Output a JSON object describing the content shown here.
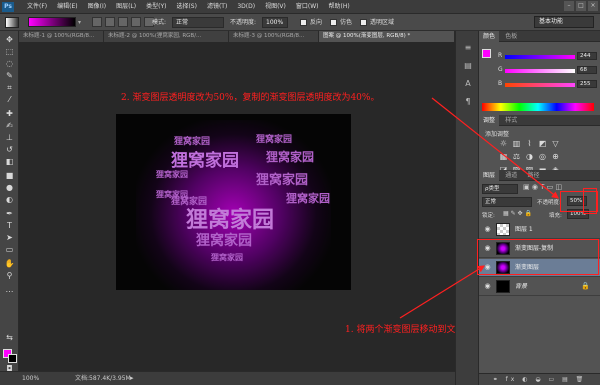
{
  "menubar": {
    "logo": "Ps",
    "items": [
      "文件(F)",
      "编辑(E)",
      "图像(I)",
      "图层(L)",
      "类型(Y)",
      "选择(S)",
      "滤镜(T)",
      "3D(D)",
      "视图(V)",
      "窗口(W)",
      "帮助(H)"
    ],
    "win_min": "–",
    "win_max": "□",
    "win_close": "×"
  },
  "options": {
    "mode_label": "模式:",
    "mode_value": "正常",
    "opacity_label": "不透明度:",
    "opacity_value": "100%",
    "reverse_label": "反向",
    "dither_label": "仿色",
    "transparency_label": "透明区域",
    "workspace": "基本功能"
  },
  "tabs": [
    {
      "label": "未标题-1 @ 100%(RGB/8...",
      "active": false
    },
    {
      "label": "未标题-2 @ 100%(狸窝家园, RGB/...",
      "active": false
    },
    {
      "label": "未标题-3 @ 100%(RGB/8...",
      "active": false
    },
    {
      "label": "图案 @ 100%(渐变图层, RGB/8) *",
      "active": true
    }
  ],
  "canvas": {
    "heart_words": [
      {
        "text": "狸窝家园",
        "size": 9
      },
      {
        "text": "狸窝家园",
        "size": 17
      },
      {
        "text": "狸窝家园",
        "size": 9
      },
      {
        "text": "狸窝家园",
        "size": 12
      },
      {
        "text": "狸窝家园",
        "size": 8
      },
      {
        "text": "狸窝家园",
        "size": 13
      },
      {
        "text": "狸窝家园",
        "size": 8
      },
      {
        "text": "狸窝家园",
        "size": 22
      },
      {
        "text": "狸窝家园",
        "size": 14
      },
      {
        "text": "狸窝家园",
        "size": 9
      },
      {
        "text": "狸窝家园",
        "size": 8
      },
      {
        "text": "狸窝家园",
        "size": 11
      }
    ]
  },
  "annotations": {
    "step2": "2. 渐变图层透明度改为50%，复制的渐变图层透明度改为40%。",
    "step1": "1. 将两个渐变图层移动到文字图层下方",
    "color": "#ff2020"
  },
  "status": {
    "zoom": "100%",
    "doc": "文档:587.4K/3.95M"
  },
  "color_panel": {
    "tabs": [
      "颜色",
      "色板"
    ],
    "r_label": "R",
    "g_label": "G",
    "b_label": "B",
    "r": "244",
    "g": "68",
    "b": "255",
    "fg_color": "#ff00ff"
  },
  "adjust_panel": {
    "tabs": [
      "调整",
      "样式"
    ],
    "title": "添加调整"
  },
  "layers_panel": {
    "tabs": [
      "图层",
      "通道",
      "路径"
    ],
    "kind": "ρ类型",
    "blend": "正常",
    "opacity_label": "不透明度:",
    "opacity_value": "50%",
    "lock_label": "锁定:",
    "fill_label": "填充:",
    "fill_value": "100%",
    "layers": [
      {
        "name": "图层 1",
        "selected": false
      },
      {
        "name": "渐变图层-复制",
        "selected": false
      },
      {
        "name": "渐变图层",
        "selected": true
      },
      {
        "name": "背景",
        "selected": false
      }
    ]
  }
}
